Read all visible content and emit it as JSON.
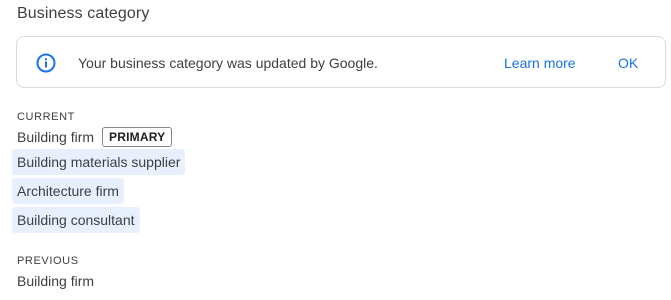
{
  "section": {
    "title": "Business category"
  },
  "banner": {
    "icon": "info-icon",
    "message": "Your business category was updated by Google.",
    "learn_more_label": "Learn more",
    "ok_label": "OK",
    "accent_color": "#1a73e8"
  },
  "current": {
    "label": "CURRENT",
    "primary_category": "Building firm",
    "primary_badge": "PRIMARY",
    "additional_categories": [
      "Building materials supplier",
      "Architecture firm",
      "Building consultant"
    ],
    "highlight_color": "#e8f0fe"
  },
  "previous": {
    "label": "PREVIOUS",
    "category": "Building firm"
  }
}
